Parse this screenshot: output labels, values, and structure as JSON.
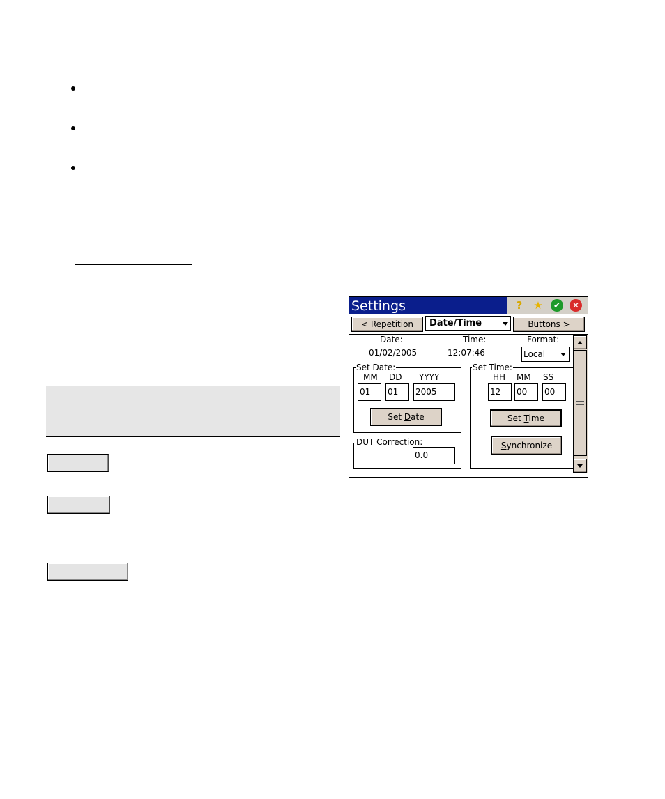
{
  "device": {
    "title": "Settings",
    "title_icons": [
      "help-icon",
      "star-icon",
      "ok-icon",
      "close-icon"
    ],
    "nav": {
      "prev_label": "< Repetition",
      "current_tab": "Date/Time",
      "next_label": "Buttons >"
    },
    "status": {
      "date_label": "Date:",
      "date_value": "01/02/2005",
      "time_label": "Time:",
      "time_value": "12:07:46",
      "format_label": "Format:",
      "format_value": "Local"
    },
    "set_date": {
      "group_label": "Set Date:",
      "mm_label": "MM",
      "dd_label": "DD",
      "yyyy_label": "YYYY",
      "mm_value": "01",
      "dd_value": "01",
      "yyyy_value": "2005",
      "button_pre": "Set ",
      "button_accel": "D",
      "button_post": "ate"
    },
    "set_time": {
      "group_label": "Set Time:",
      "hh_label": "HH",
      "mm_label": "MM",
      "ss_label": "SS",
      "hh_value": "12",
      "mm_value": "00",
      "ss_value": "00",
      "button_pre": "Set ",
      "button_accel": "T",
      "button_post": "ime",
      "sync_accel": "S",
      "sync_post": "ynchronize"
    },
    "dut": {
      "group_label": "DUT Correction:",
      "value": "0.0"
    },
    "colors": {
      "titlebar": "#0a1e8c",
      "button_face": "#ddd3c8"
    }
  }
}
